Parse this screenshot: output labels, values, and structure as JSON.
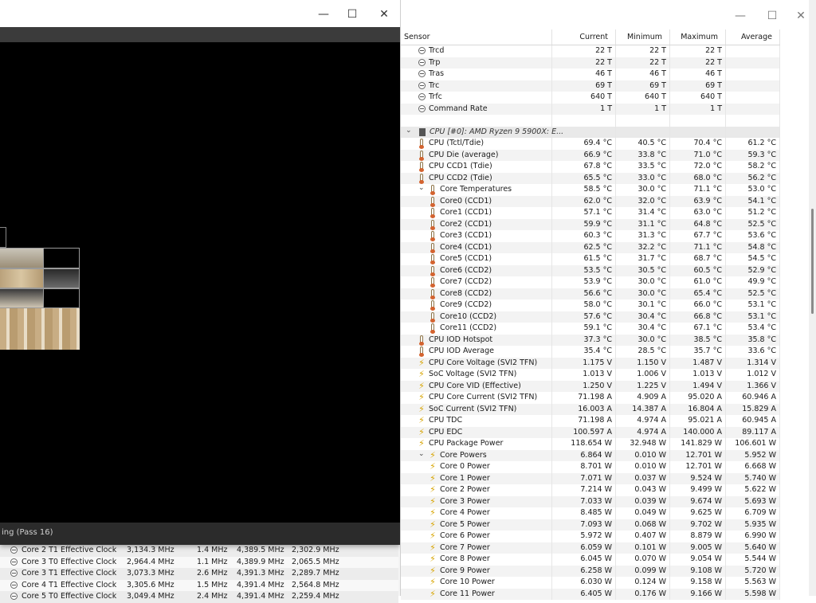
{
  "render_window": {
    "minimize_glyph": "—",
    "maximize_glyph": "☐",
    "close_glyph": "✕",
    "status_text": "ing (Pass 16)"
  },
  "bg_window": {
    "rows": [
      {
        "label": "Core 2 T1 Effective Clock",
        "current": "3,134.3 MHz",
        "min": "1.4 MHz",
        "max": "4,389.5 MHz",
        "avg": "2,302.9 MHz"
      },
      {
        "label": "Core 3 T0 Effective Clock",
        "current": "2,964.4 MHz",
        "min": "1.1 MHz",
        "max": "4,389.9 MHz",
        "avg": "2,065.5 MHz"
      },
      {
        "label": "Core 3 T1 Effective Clock",
        "current": "3,073.3 MHz",
        "min": "2.6 MHz",
        "max": "4,391.3 MHz",
        "avg": "2,289.7 MHz"
      },
      {
        "label": "Core 4 T1 Effective Clock",
        "current": "3,305.6 MHz",
        "min": "1.5 MHz",
        "max": "4,391.4 MHz",
        "avg": "2,564.8 MHz"
      },
      {
        "label": "Core 5 T0 Effective Clock",
        "current": "3,049.4 MHz",
        "min": "2.4 MHz",
        "max": "4,391.4 MHz",
        "avg": "2,259.4 MHz"
      }
    ]
  },
  "sensor_window": {
    "minimize_glyph": "—",
    "maximize_glyph": "☐",
    "close_glyph": "✕",
    "headers": {
      "sensor": "Sensor",
      "current": "Current",
      "min": "Minimum",
      "max": "Maximum",
      "avg": "Average"
    },
    "rows": [
      {
        "type": "clock",
        "indent": 1,
        "label": "Trcd",
        "cur": "22 T",
        "min": "22 T",
        "max": "22 T",
        "avg": ""
      },
      {
        "type": "clock",
        "indent": 1,
        "label": "Trp",
        "cur": "22 T",
        "min": "22 T",
        "max": "22 T",
        "avg": ""
      },
      {
        "type": "clock",
        "indent": 1,
        "label": "Tras",
        "cur": "46 T",
        "min": "46 T",
        "max": "46 T",
        "avg": ""
      },
      {
        "type": "clock",
        "indent": 1,
        "label": "Trc",
        "cur": "69 T",
        "min": "69 T",
        "max": "69 T",
        "avg": ""
      },
      {
        "type": "clock",
        "indent": 1,
        "label": "Trfc",
        "cur": "640 T",
        "min": "640 T",
        "max": "640 T",
        "avg": ""
      },
      {
        "type": "clock",
        "indent": 1,
        "label": "Command Rate",
        "cur": "1 T",
        "min": "1 T",
        "max": "1 T",
        "avg": ""
      },
      {
        "type": "blank",
        "indent": 0,
        "label": "",
        "cur": "",
        "min": "",
        "max": "",
        "avg": ""
      },
      {
        "type": "group",
        "indent": 0,
        "label": "CPU [#0]: AMD Ryzen 9 5900X: E...",
        "cur": "",
        "min": "",
        "max": "",
        "avg": ""
      },
      {
        "type": "temp",
        "indent": 1,
        "label": "CPU (Tctl/Tdie)",
        "cur": "69.4 °C",
        "min": "40.5 °C",
        "max": "70.4 °C",
        "avg": "61.2 °C"
      },
      {
        "type": "temp",
        "indent": 1,
        "label": "CPU Die (average)",
        "cur": "66.9 °C",
        "min": "33.8 °C",
        "max": "71.0 °C",
        "avg": "59.3 °C"
      },
      {
        "type": "temp",
        "indent": 1,
        "label": "CPU CCD1 (Tdie)",
        "cur": "67.8 °C",
        "min": "33.5 °C",
        "max": "72.0 °C",
        "avg": "58.2 °C"
      },
      {
        "type": "temp",
        "indent": 1,
        "label": "CPU CCD2 (Tdie)",
        "cur": "65.5 °C",
        "min": "33.0 °C",
        "max": "68.0 °C",
        "avg": "56.2 °C"
      },
      {
        "type": "temp",
        "indent": 2,
        "expand": true,
        "label": "Core Temperatures",
        "cur": "58.5 °C",
        "min": "30.0 °C",
        "max": "71.1 °C",
        "avg": "53.0 °C"
      },
      {
        "type": "temp",
        "indent": 2,
        "label": "Core0 (CCD1)",
        "cur": "62.0 °C",
        "min": "32.0 °C",
        "max": "63.9 °C",
        "avg": "54.1 °C"
      },
      {
        "type": "temp",
        "indent": 2,
        "label": "Core1 (CCD1)",
        "cur": "57.1 °C",
        "min": "31.4 °C",
        "max": "63.0 °C",
        "avg": "51.2 °C"
      },
      {
        "type": "temp",
        "indent": 2,
        "label": "Core2 (CCD1)",
        "cur": "59.9 °C",
        "min": "31.1 °C",
        "max": "64.8 °C",
        "avg": "52.5 °C"
      },
      {
        "type": "temp",
        "indent": 2,
        "label": "Core3 (CCD1)",
        "cur": "60.3 °C",
        "min": "31.3 °C",
        "max": "67.7 °C",
        "avg": "53.6 °C"
      },
      {
        "type": "temp",
        "indent": 2,
        "label": "Core4 (CCD1)",
        "cur": "62.5 °C",
        "min": "32.2 °C",
        "max": "71.1 °C",
        "avg": "54.8 °C"
      },
      {
        "type": "temp",
        "indent": 2,
        "label": "Core5 (CCD1)",
        "cur": "61.5 °C",
        "min": "31.7 °C",
        "max": "68.7 °C",
        "avg": "54.5 °C"
      },
      {
        "type": "temp",
        "indent": 2,
        "label": "Core6 (CCD2)",
        "cur": "53.5 °C",
        "min": "30.5 °C",
        "max": "60.5 °C",
        "avg": "52.9 °C"
      },
      {
        "type": "temp",
        "indent": 2,
        "label": "Core7 (CCD2)",
        "cur": "53.9 °C",
        "min": "30.0 °C",
        "max": "61.0 °C",
        "avg": "49.9 °C"
      },
      {
        "type": "temp",
        "indent": 2,
        "label": "Core8 (CCD2)",
        "cur": "56.6 °C",
        "min": "30.0 °C",
        "max": "65.4 °C",
        "avg": "52.5 °C"
      },
      {
        "type": "temp",
        "indent": 2,
        "label": "Core9 (CCD2)",
        "cur": "58.0 °C",
        "min": "30.1 °C",
        "max": "66.0 °C",
        "avg": "53.1 °C"
      },
      {
        "type": "temp",
        "indent": 2,
        "label": "Core10 (CCD2)",
        "cur": "57.6 °C",
        "min": "30.4 °C",
        "max": "66.8 °C",
        "avg": "53.1 °C"
      },
      {
        "type": "temp",
        "indent": 2,
        "label": "Core11 (CCD2)",
        "cur": "59.1 °C",
        "min": "30.4 °C",
        "max": "67.1 °C",
        "avg": "53.4 °C"
      },
      {
        "type": "temp",
        "indent": 1,
        "label": "CPU IOD Hotspot",
        "cur": "37.3 °C",
        "min": "30.0 °C",
        "max": "38.5 °C",
        "avg": "35.8 °C"
      },
      {
        "type": "temp",
        "indent": 1,
        "label": "CPU IOD Average",
        "cur": "35.4 °C",
        "min": "28.5 °C",
        "max": "35.7 °C",
        "avg": "33.6 °C"
      },
      {
        "type": "volt",
        "indent": 1,
        "label": "CPU Core Voltage (SVI2 TFN)",
        "cur": "1.175 V",
        "min": "1.150 V",
        "max": "1.487 V",
        "avg": "1.314 V"
      },
      {
        "type": "volt",
        "indent": 1,
        "label": "SoC Voltage (SVI2 TFN)",
        "cur": "1.013 V",
        "min": "1.006 V",
        "max": "1.013 V",
        "avg": "1.012 V"
      },
      {
        "type": "volt",
        "indent": 1,
        "label": "CPU Core VID (Effective)",
        "cur": "1.250 V",
        "min": "1.225 V",
        "max": "1.494 V",
        "avg": "1.366 V"
      },
      {
        "type": "volt",
        "indent": 1,
        "label": "CPU Core Current (SVI2 TFN)",
        "cur": "71.198 A",
        "min": "4.909 A",
        "max": "95.020 A",
        "avg": "60.946 A"
      },
      {
        "type": "volt",
        "indent": 1,
        "label": "SoC Current (SVI2 TFN)",
        "cur": "16.003 A",
        "min": "14.387 A",
        "max": "16.804 A",
        "avg": "15.829 A"
      },
      {
        "type": "volt",
        "indent": 1,
        "label": "CPU TDC",
        "cur": "71.198 A",
        "min": "4.974 A",
        "max": "95.021 A",
        "avg": "60.945 A"
      },
      {
        "type": "volt",
        "indent": 1,
        "label": "CPU EDC",
        "cur": "100.597 A",
        "min": "4.974 A",
        "max": "140.000 A",
        "avg": "89.117 A"
      },
      {
        "type": "volt",
        "indent": 1,
        "label": "CPU Package Power",
        "cur": "118.654 W",
        "min": "32.948 W",
        "max": "141.829 W",
        "avg": "106.601 W"
      },
      {
        "type": "volt",
        "indent": 2,
        "expand": true,
        "label": "Core Powers",
        "cur": "6.864 W",
        "min": "0.010 W",
        "max": "12.701 W",
        "avg": "5.952 W"
      },
      {
        "type": "volt",
        "indent": 2,
        "label": "Core 0 Power",
        "cur": "8.701 W",
        "min": "0.010 W",
        "max": "12.701 W",
        "avg": "6.668 W"
      },
      {
        "type": "volt",
        "indent": 2,
        "label": "Core 1 Power",
        "cur": "7.071 W",
        "min": "0.037 W",
        "max": "9.524 W",
        "avg": "5.740 W"
      },
      {
        "type": "volt",
        "indent": 2,
        "label": "Core 2 Power",
        "cur": "7.214 W",
        "min": "0.043 W",
        "max": "9.499 W",
        "avg": "5.622 W"
      },
      {
        "type": "volt",
        "indent": 2,
        "label": "Core 3 Power",
        "cur": "7.033 W",
        "min": "0.039 W",
        "max": "9.674 W",
        "avg": "5.693 W"
      },
      {
        "type": "volt",
        "indent": 2,
        "label": "Core 4 Power",
        "cur": "8.485 W",
        "min": "0.049 W",
        "max": "9.625 W",
        "avg": "6.709 W"
      },
      {
        "type": "volt",
        "indent": 2,
        "label": "Core 5 Power",
        "cur": "7.093 W",
        "min": "0.068 W",
        "max": "9.702 W",
        "avg": "5.935 W"
      },
      {
        "type": "volt",
        "indent": 2,
        "label": "Core 6 Power",
        "cur": "5.972 W",
        "min": "0.407 W",
        "max": "8.879 W",
        "avg": "6.990 W"
      },
      {
        "type": "volt",
        "indent": 2,
        "label": "Core 7 Power",
        "cur": "6.059 W",
        "min": "0.101 W",
        "max": "9.005 W",
        "avg": "5.640 W"
      },
      {
        "type": "volt",
        "indent": 2,
        "label": "Core 8 Power",
        "cur": "6.045 W",
        "min": "0.070 W",
        "max": "9.054 W",
        "avg": "5.544 W"
      },
      {
        "type": "volt",
        "indent": 2,
        "label": "Core 9 Power",
        "cur": "6.258 W",
        "min": "0.099 W",
        "max": "9.108 W",
        "avg": "5.720 W"
      },
      {
        "type": "volt",
        "indent": 2,
        "label": "Core 10 Power",
        "cur": "6.030 W",
        "min": "0.124 W",
        "max": "9.158 W",
        "avg": "5.563 W"
      },
      {
        "type": "volt",
        "indent": 2,
        "label": "Core 11 Power",
        "cur": "6.405 W",
        "min": "0.176 W",
        "max": "9.166 W",
        "avg": "5.598 W"
      }
    ]
  }
}
